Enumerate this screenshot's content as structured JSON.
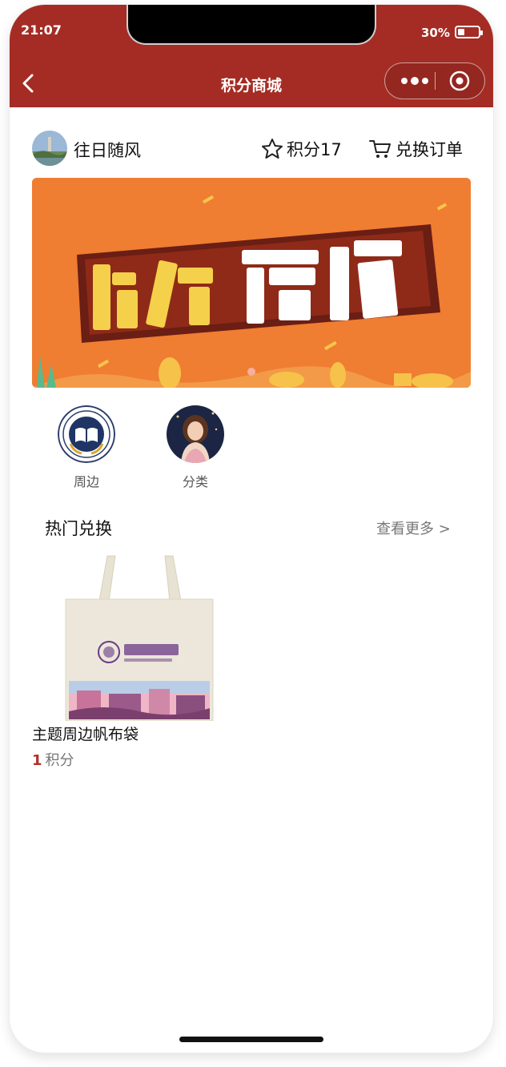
{
  "status_bar": {
    "time": "21:07",
    "battery": "30%"
  },
  "nav": {
    "title": "积分商城"
  },
  "user": {
    "name": "往日随风",
    "points_label": "积分17",
    "orders_label": "兑换订单"
  },
  "categories": [
    {
      "label": "周边"
    },
    {
      "label": "分类"
    }
  ],
  "hot": {
    "title": "热门兑换",
    "more": "查看更多 >",
    "items": [
      {
        "name": "主题周边帆布袋",
        "price": "1",
        "unit": "积分"
      }
    ]
  },
  "colors": {
    "brand": "#a52c24",
    "banner": "#ef7d32",
    "price": "#b2302a"
  }
}
